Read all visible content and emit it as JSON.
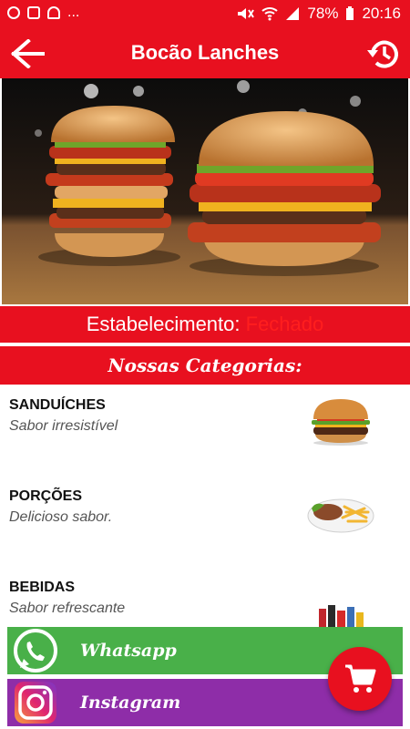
{
  "status_bar": {
    "battery": "78%",
    "time": "20:16",
    "overflow": "..."
  },
  "app_bar": {
    "title": "Bocão Lanches",
    "back_icon": "arrow-left-icon",
    "history_icon": "history-icon"
  },
  "hero": {
    "image": "burgers-photo"
  },
  "establishment": {
    "label": "Estabelecimento:",
    "status": "Fechado",
    "status_color": "#ff1e1e"
  },
  "categories_title": "Nossas Categorias:",
  "categories": [
    {
      "name": "SANDUÍCHES",
      "description": "Sabor irresistível",
      "icon": "burger-icon"
    },
    {
      "name": "PORÇÕES",
      "description": "Delicioso sabor.",
      "icon": "portion-plate-icon"
    },
    {
      "name": "BEBIDAS",
      "description": "Sabor refrescante",
      "icon": "drinks-icon"
    }
  ],
  "social": {
    "whatsapp": "Whatsapp",
    "instagram": "Instagram"
  },
  "colors": {
    "primary": "#e8101f",
    "whatsapp": "#49b049",
    "instagram": "#8e2da8"
  },
  "fab_icon": "cart-icon"
}
